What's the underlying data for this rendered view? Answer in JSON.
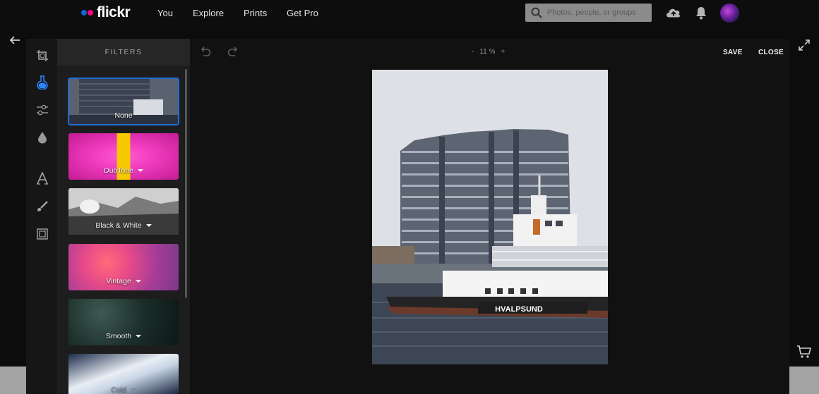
{
  "header": {
    "logo_text": "flickr",
    "nav": [
      "You",
      "Explore",
      "Prints",
      "Get Pro"
    ],
    "search_placeholder": "Photos, people, or groups"
  },
  "editor": {
    "panel_title": "FILTERS",
    "zoom": {
      "minus": "-",
      "value": "11 %",
      "plus": "+"
    },
    "save_label": "SAVE",
    "close_label": "CLOSE",
    "filters": [
      {
        "label": "None",
        "selected": true
      },
      {
        "label": "DuoTone",
        "has_menu": true
      },
      {
        "label": "Black & White",
        "has_menu": true
      },
      {
        "label": "Vintage",
        "has_menu": true
      },
      {
        "label": "Smooth",
        "has_menu": true
      },
      {
        "label": "Cold",
        "has_menu": true
      }
    ],
    "photo": {
      "boat_name": "HVALPSUND"
    }
  },
  "colors": {
    "accent": "#1e6dd6",
    "flickr_blue": "#1065d4",
    "flickr_pink": "#ff0084"
  }
}
